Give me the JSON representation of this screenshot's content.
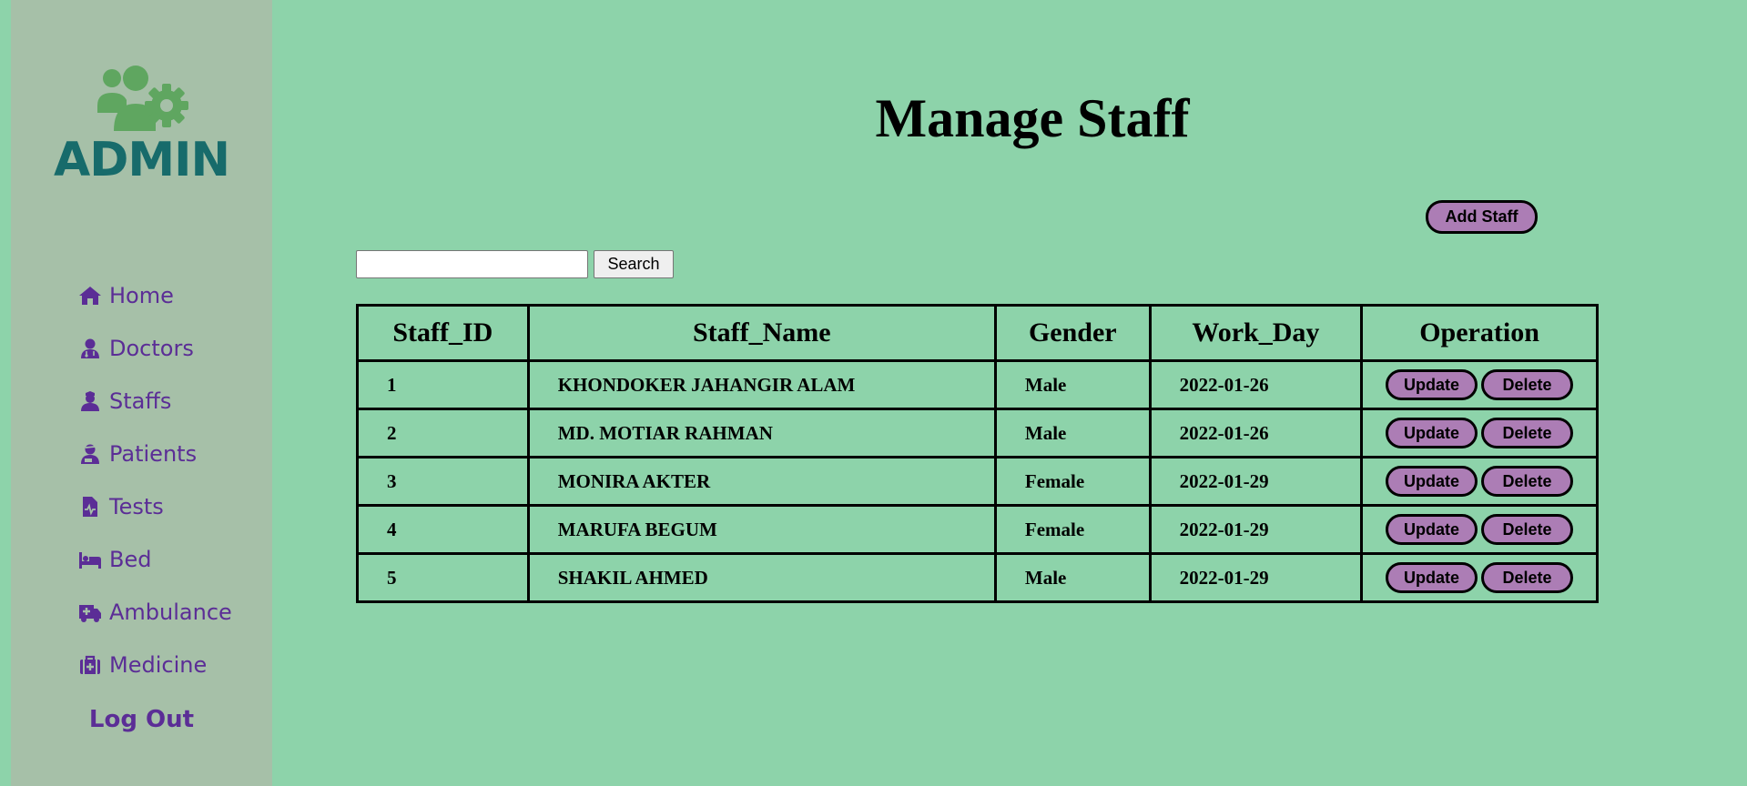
{
  "sidebar": {
    "logo_text": "ADMIN",
    "logo_icon": "users-gear-icon",
    "items": [
      {
        "label": "Home",
        "icon": "home-icon"
      },
      {
        "label": "Doctors",
        "icon": "user-doctor-icon"
      },
      {
        "label": "Staffs",
        "icon": "user-nurse-icon"
      },
      {
        "label": "Patients",
        "icon": "user-injured-icon"
      },
      {
        "label": "Tests",
        "icon": "file-medical-icon"
      },
      {
        "label": "Bed",
        "icon": "bed-icon"
      },
      {
        "label": "Ambulance",
        "icon": "truck-medical-icon"
      },
      {
        "label": "Medicine",
        "icon": "medkit-icon"
      }
    ],
    "logout_label": "Log Out"
  },
  "main": {
    "title": "Manage Staff",
    "add_button": "Add Staff",
    "search": {
      "value": "",
      "placeholder": "",
      "button": "Search"
    },
    "table": {
      "headers": [
        "Staff_ID",
        "Staff_Name",
        "Gender",
        "Work_Day",
        "Operation"
      ],
      "rows": [
        {
          "id": "1",
          "name": "KHONDOKER JAHANGIR ALAM",
          "gender": "Male",
          "work_day": "2022-01-26",
          "update": "Update",
          "delete": "Delete"
        },
        {
          "id": "2",
          "name": "MD. MOTIAR RAHMAN",
          "gender": "Male",
          "work_day": "2022-01-26",
          "update": "Update",
          "delete": "Delete"
        },
        {
          "id": "3",
          "name": "MONIRA AKTER",
          "gender": "Female",
          "work_day": "2022-01-29",
          "update": "Update",
          "delete": "Delete"
        },
        {
          "id": "4",
          "name": "MARUFA BEGUM",
          "gender": "Female",
          "work_day": "2022-01-29",
          "update": "Update",
          "delete": "Delete"
        },
        {
          "id": "5",
          "name": "SHAKIL AHMED",
          "gender": "Male",
          "work_day": "2022-01-29",
          "update": "Update",
          "delete": "Delete"
        }
      ]
    }
  },
  "colors": {
    "background": "#8dd3aa",
    "sidebar": "#a6c0a8",
    "logo_text": "#176b6b",
    "logo_icon": "#5fa660",
    "nav_text": "#5b2d96",
    "button_fill": "#ac7db5"
  }
}
